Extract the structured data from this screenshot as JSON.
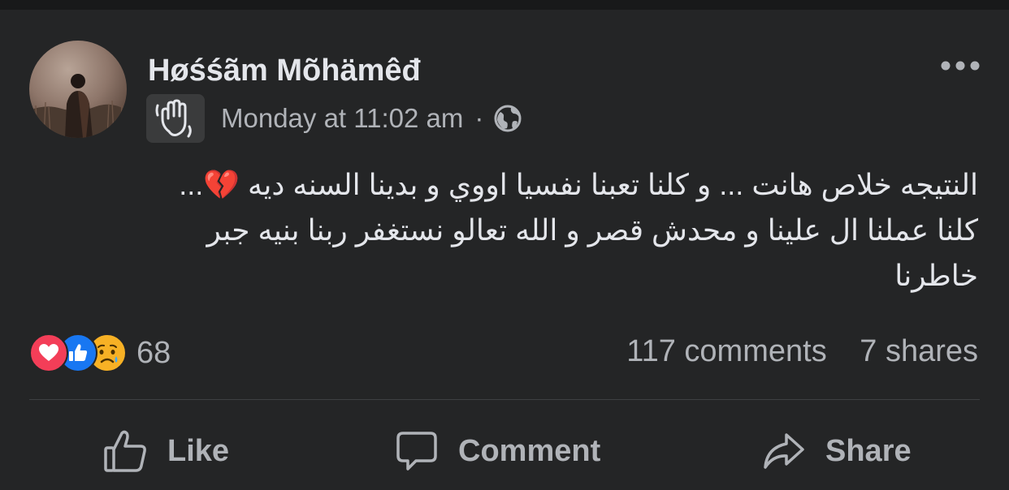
{
  "post": {
    "author": "Høśśãm Mõhämêđ",
    "time": "Monday at 11:02 am",
    "separator": "·",
    "audience_icon": "globe-icon",
    "badge_icon": "waving-hand-icon",
    "text_lines": [
      "النتيجه خلاص هانت ... و كلنا تعبنا نفسيا اووي و بدينا السنه ديه 💔...",
      "كلنا عملنا ال علينا و محدش قصر و الله تعالو نستغفر ربنا بنيه جبر",
      "خاطرنا"
    ]
  },
  "engagement": {
    "reaction_icons": [
      "love-icon",
      "like-icon",
      "sad-icon"
    ],
    "reaction_count": "68",
    "comments": "117 comments",
    "shares": "7 shares"
  },
  "actions": {
    "like_label": "Like",
    "comment_label": "Comment",
    "share_label": "Share"
  },
  "colors": {
    "background": "#242526",
    "text_primary": "#e4e6eb",
    "text_secondary": "#b0b3b8",
    "love": "#f33e58",
    "like": "#1877f2",
    "sad": "#f7b125"
  }
}
